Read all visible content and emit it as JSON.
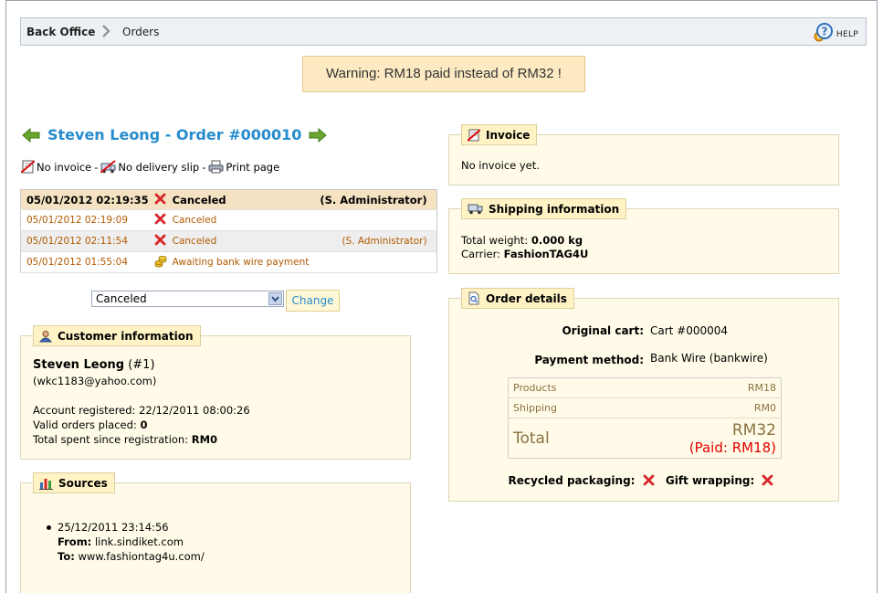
{
  "breadcrumb": {
    "root": "Back Office",
    "current": "Orders"
  },
  "help": {
    "label": "HELP"
  },
  "warning": {
    "text": "Warning: RM18 paid instead of RM32 !"
  },
  "order": {
    "title": "Steven Leong - Order #000010",
    "actions": {
      "no_invoice": "No invoice",
      "no_delivery_slip": "No delivery slip",
      "print_page": "Print page",
      "separator": "-"
    }
  },
  "history": [
    {
      "date": "05/01/2012 02:19:35",
      "status": "Canceled",
      "status_icon": "red-x-icon",
      "by": "(S. Administrator)"
    },
    {
      "date": "05/01/2012 02:19:09",
      "status": "Canceled",
      "status_icon": "red-x-icon",
      "by": ""
    },
    {
      "date": "05/01/2012 02:11:54",
      "status": "Canceled",
      "status_icon": "red-x-icon",
      "by": "(S. Administrator)"
    },
    {
      "date": "05/01/2012 01:55:04",
      "status": "Awaiting bank wire payment",
      "status_icon": "coins-icon",
      "by": ""
    }
  ],
  "state_change": {
    "selected": "Canceled",
    "button": "Change"
  },
  "customer": {
    "legend": "Customer information",
    "name": "Steven Leong",
    "id": "(#1)",
    "email": "(wkc1183@yahoo.com)",
    "registered_label": "Account registered:",
    "registered_value": "22/12/2011 08:00:26",
    "valid_orders_label": "Valid orders placed:",
    "valid_orders_value": "0",
    "total_spent_label": "Total spent since registration:",
    "total_spent_value": "RM0"
  },
  "sources": {
    "legend": "Sources",
    "items": [
      {
        "date": "25/12/2011 23:14:56",
        "from_label": "From:",
        "from": "link.sindiket.com",
        "to_label": "To:",
        "to": "www.fashiontag4u.com/"
      }
    ]
  },
  "invoice": {
    "legend": "Invoice",
    "text": "No invoice yet."
  },
  "shipping": {
    "legend": "Shipping information",
    "weight_label": "Total weight:",
    "weight_value": "0.000 kg",
    "carrier_label": "Carrier:",
    "carrier_value": "FashionTAG4U"
  },
  "details": {
    "legend": "Order details",
    "original_cart_label": "Original cart:",
    "original_cart_value": "Cart #000004",
    "payment_label": "Payment method:",
    "payment_value": "Bank Wire (bankwire)",
    "products_label": "Products",
    "products_value": "RM18",
    "shipping_label": "Shipping",
    "shipping_value": "RM0",
    "total_label": "Total",
    "total_value": "RM32",
    "paid_value": "(Paid: RM18)",
    "recycled_label": "Recycled packaging:",
    "gift_label": "Gift wrapping:"
  },
  "colors": {
    "title_blue": "#268ccd",
    "warning_bg": "#fde9c2",
    "box_bg": "#fffbe8",
    "paid_red": "#e30000"
  }
}
